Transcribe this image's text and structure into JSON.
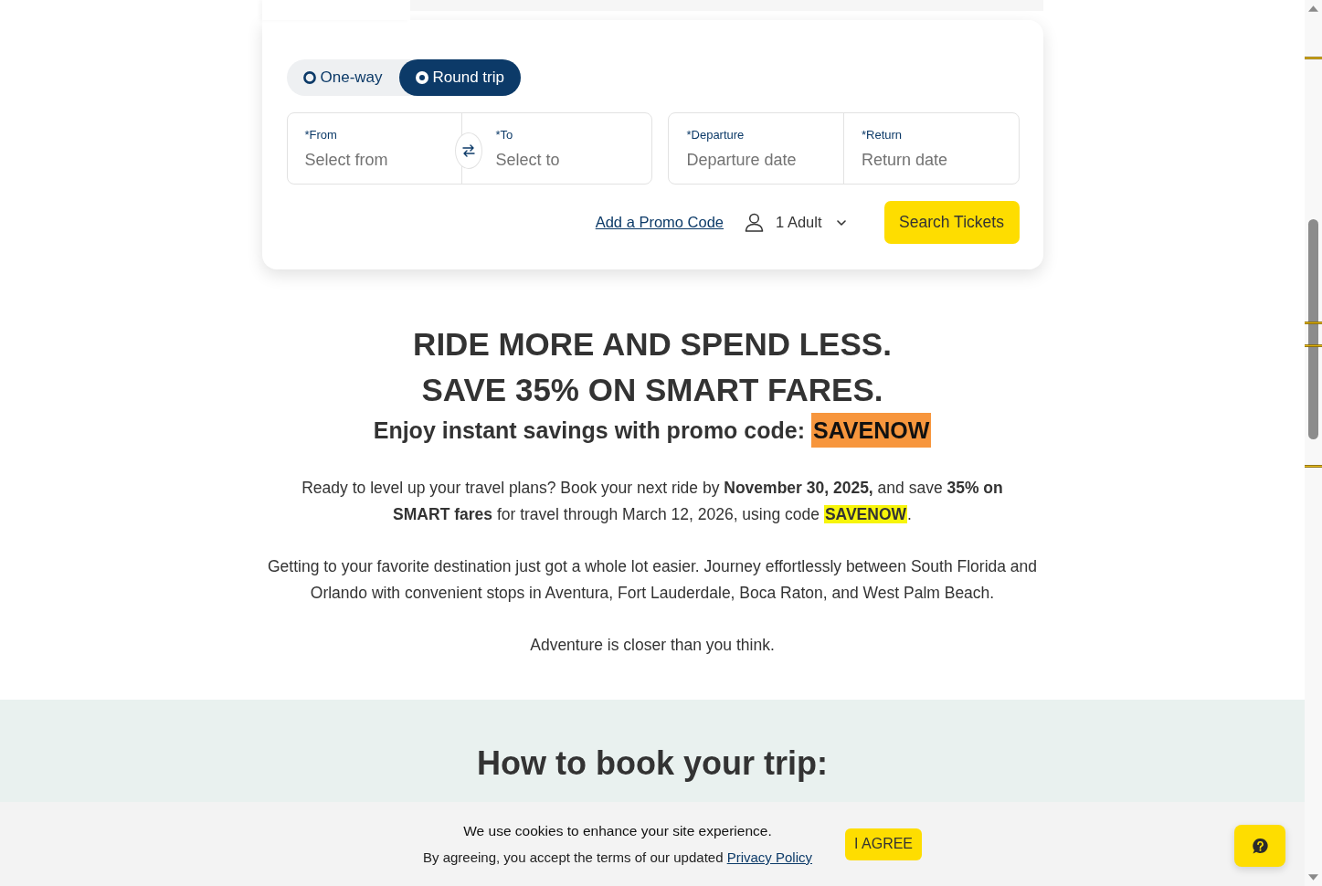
{
  "booking": {
    "trip_type": [
      {
        "label": "One-way",
        "selected": false
      },
      {
        "label": "Round trip",
        "selected": true
      }
    ],
    "route_fields": [
      {
        "label": "*From",
        "placeholder": "Select from"
      },
      {
        "label": "*To",
        "placeholder": "Select to"
      }
    ],
    "date_fields": [
      {
        "label": "*Departure",
        "placeholder": "Departure date"
      },
      {
        "label": "*Return",
        "placeholder": "Return date"
      }
    ],
    "promo_link": "Add a Promo Code",
    "passengers": "1 Adult",
    "search_button": "Search Tickets"
  },
  "promo": {
    "headline": [
      "RIDE MORE AND SPEND LESS.",
      "SAVE 35% ON SMART FARES."
    ],
    "subheading": [
      {
        "text": "Enjoy instant savings with promo code: "
      },
      {
        "text": "SAVENOW",
        "color": "#f7963d"
      }
    ],
    "paragraphs": [
      [
        {
          "text": "Ready to level up your travel plans? Book your next ride by **November 30, 2025,** and save **35% on SMART fares** for travel through March 12, 2026, using code "
        },
        {
          "text": "**SAVENOW**",
          "color": "#f7f50a"
        },
        {
          "text": "."
        }
      ],
      [
        {
          "text": "Getting to your favorite destination just got a whole lot easier. Journey effortlessly between South Florida and Orlando with convenient stops in Aventura, Fort Lauderdale, Boca Raton, and West Palm Beach."
        }
      ],
      [
        {
          "text": "Adventure is closer than you think."
        }
      ]
    ]
  },
  "how_to_book": {
    "title": "How to book your trip:"
  },
  "cookie_banner": {
    "message": "We use cookies to enhance your site experience.",
    "terms": "By agreeing, you accept the terms of our updated",
    "link": "Privacy Policy",
    "button": "I AGREE"
  }
}
